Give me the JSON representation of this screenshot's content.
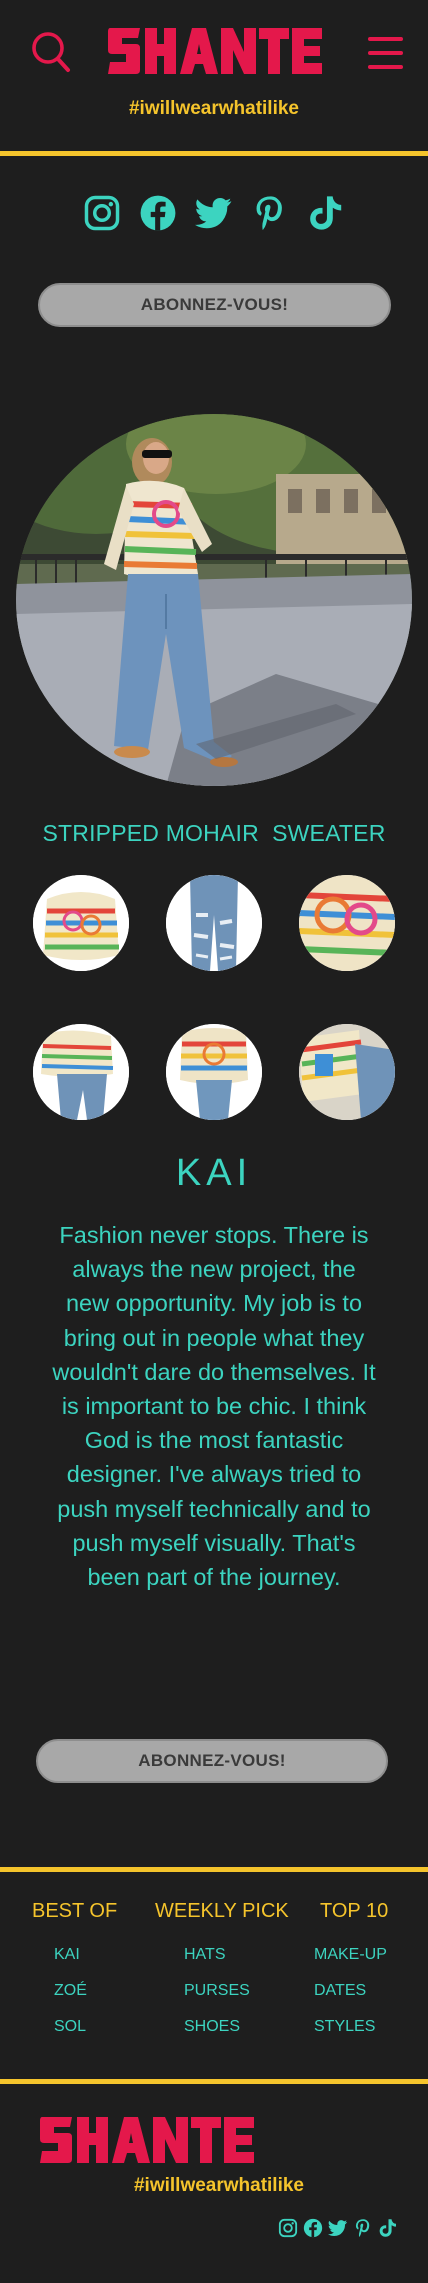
{
  "brand": {
    "logo_text": "SHANTE",
    "tagline": "#iwillwearwhatilike",
    "colors": {
      "background": "#1e1e1e",
      "brand_pink": "#e4184b",
      "accent_yellow": "#f5c42c",
      "teal": "#3cd4c0",
      "button_gray": "#a8a8a8"
    }
  },
  "header": {
    "search_icon": "search-icon",
    "menu_icon": "hamburger-menu-icon"
  },
  "social": [
    "instagram-icon",
    "facebook-icon",
    "twitter-icon",
    "pinterest-icon",
    "tiktok-icon"
  ],
  "subscribe": {
    "top_label": "ABONNEZ-VOUS!",
    "bottom_label": "ABONNEZ-VOUS!"
  },
  "product": {
    "title": "STRIPPED MOHAIR  SWEATER",
    "gallery": [
      "sweater-front",
      "jeans-back",
      "sweater-detail",
      "sweater-with-jeans",
      "sweater-folded",
      "sweater-outfit-flatlay"
    ]
  },
  "designer": {
    "name": "KAI",
    "quote": "Fashion never stops. There is always the new project, the new opportunity. My job is to bring out in people what they wouldn't dare do themselves. It is important to be chic. I think God is the most fantastic designer. I've always tried to push myself technically and to push myself visually. That's been part of the journey."
  },
  "footer": {
    "columns": [
      {
        "heading": "BEST OF",
        "links": [
          "KAI",
          "ZOÉ",
          "SOL"
        ]
      },
      {
        "heading": "WEEKLY PICK",
        "links": [
          "HATS",
          "PURSES",
          "SHOES"
        ]
      },
      {
        "heading": "TOP 10",
        "links": [
          "MAKE-UP",
          "DATES",
          "STYLES"
        ]
      }
    ],
    "logo_text": "SHANTE",
    "tagline": "#iwillwearwhatilike"
  }
}
